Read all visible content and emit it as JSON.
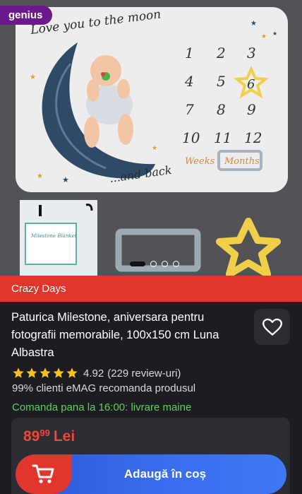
{
  "badge": {
    "label": "genius"
  },
  "gallery": {
    "blanket_title": "Love you to the moon",
    "blanket_footer": "...and back",
    "numbers": [
      "1",
      "2",
      "3",
      "4",
      "5",
      "6",
      "7",
      "8",
      "9",
      "10",
      "11",
      "12"
    ],
    "weeks_label": "Weeks",
    "months_label": "Months",
    "package_label": "Milestone Blanket",
    "dots_total": 4,
    "dots_active_index": 0
  },
  "promo": {
    "label": "Crazy Days"
  },
  "product": {
    "title": "Paturica Milestone, aniversara pentru fotografii memorabile, 100x150 cm Luna Albastra",
    "rating_value": "4.92",
    "rating_stars": 5,
    "review_count": "(229 review-uri)",
    "recommend_text": "99% clienti eMAG recomanda produsul",
    "delivery_text": "Comanda pana la 16:00: livrare maine"
  },
  "price": {
    "integer": "89",
    "decimals": "99",
    "currency": "Lei"
  },
  "cart": {
    "label": "Adaugă în coș"
  },
  "colors": {
    "background": "#1c1d21",
    "promo_red": "#e0362b",
    "price_red": "#f0453a",
    "delivery_green": "#5fcf5f",
    "star_yellow": "#f7c21a",
    "button_blue": "#3a6ff0",
    "genius_purple": "#6a1a8a"
  },
  "icons": {
    "favorite": "heart-icon",
    "cart": "shopping-cart-icon",
    "star": "star-icon"
  }
}
